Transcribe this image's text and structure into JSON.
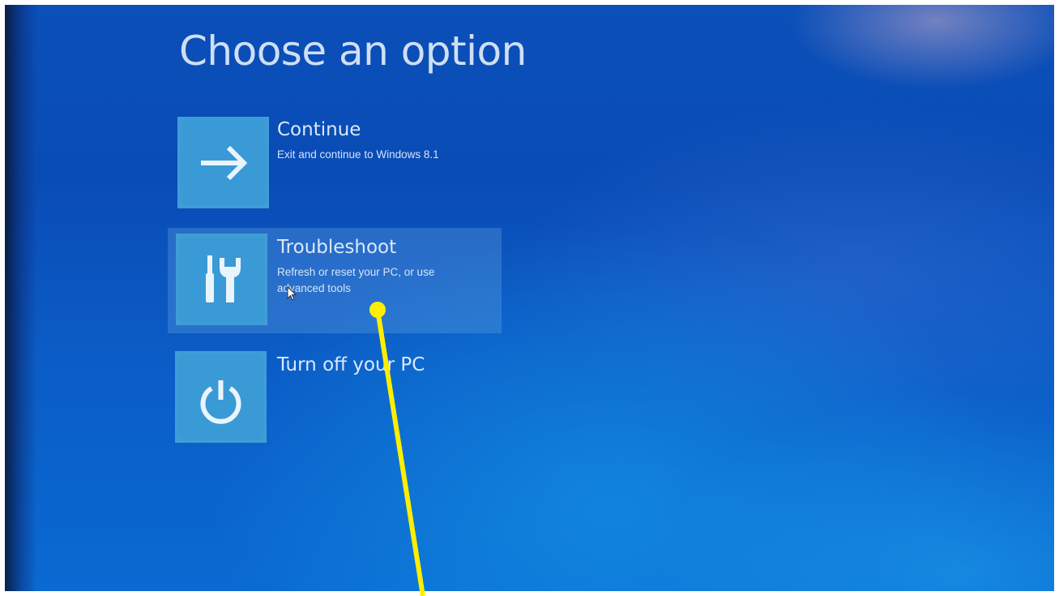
{
  "page": {
    "title": "Choose an option"
  },
  "options": [
    {
      "icon": "arrow-right-icon",
      "title": "Continue",
      "description": "Exit and continue to Windows 8.1"
    },
    {
      "icon": "screwdriver-wrench-icon",
      "title": "Troubleshoot",
      "description": "Refresh or reset your PC, or use advanced tools",
      "highlighted": true
    },
    {
      "icon": "power-icon",
      "title": "Turn off your PC",
      "description": ""
    }
  ],
  "colors": {
    "background": "#0b55c0",
    "tile": "#3a9ad6",
    "text": "#e6f0fc",
    "annotation": "#ffee00"
  }
}
